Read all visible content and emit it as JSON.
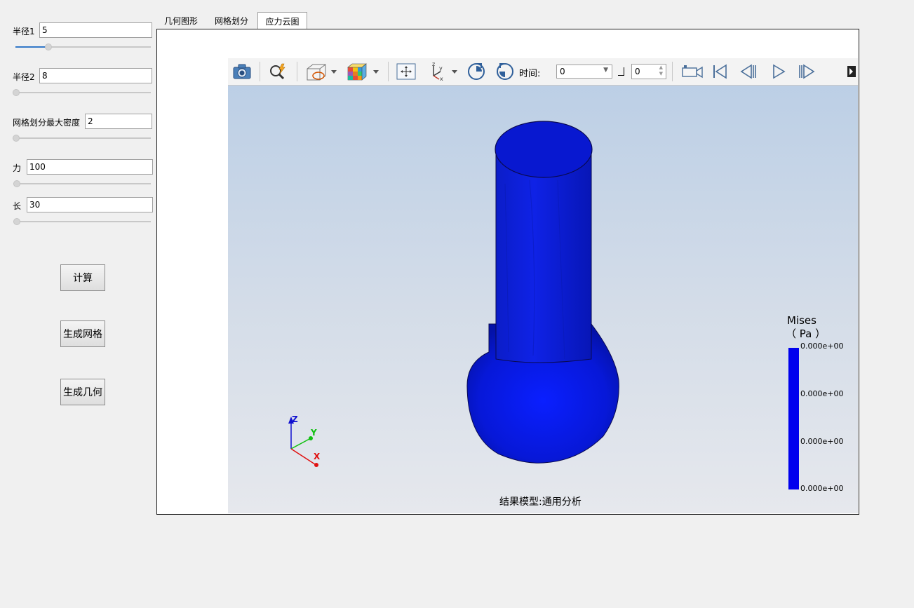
{
  "params": {
    "radius1": {
      "label": "半径1",
      "value": "5",
      "slider_fraction": 0.24
    },
    "radius2": {
      "label": "半径2",
      "value": "8",
      "slider_fraction": 0.0
    },
    "mesh_density": {
      "label": "网格划分最大密度",
      "value": "2",
      "slider_fraction": 0.0
    },
    "force": {
      "label": "力",
      "value": "100",
      "slider_fraction": 0.0
    },
    "length": {
      "label": "长",
      "value": "30",
      "slider_fraction": 0.0
    }
  },
  "buttons": {
    "calculate": "计算",
    "generate_mesh": "生成网格",
    "generate_geometry": "生成几何"
  },
  "tabs": [
    {
      "label": "几何图形",
      "active": false
    },
    {
      "label": "网格划分",
      "active": false
    },
    {
      "label": "应力云图",
      "active": true
    }
  ],
  "toolbar": {
    "time_label": "时间:",
    "time_value": "0",
    "step_value": "0"
  },
  "legend": {
    "title": "Mises",
    "unit": "（ Pa ）",
    "values": [
      "0.000e+00",
      "0.000e+00",
      "0.000e+00",
      "0.000e+00"
    ],
    "color": "#0000ee"
  },
  "axes": {
    "z": "Z",
    "y": "Y",
    "x": "X"
  },
  "caption": "结果模型:通用分析"
}
